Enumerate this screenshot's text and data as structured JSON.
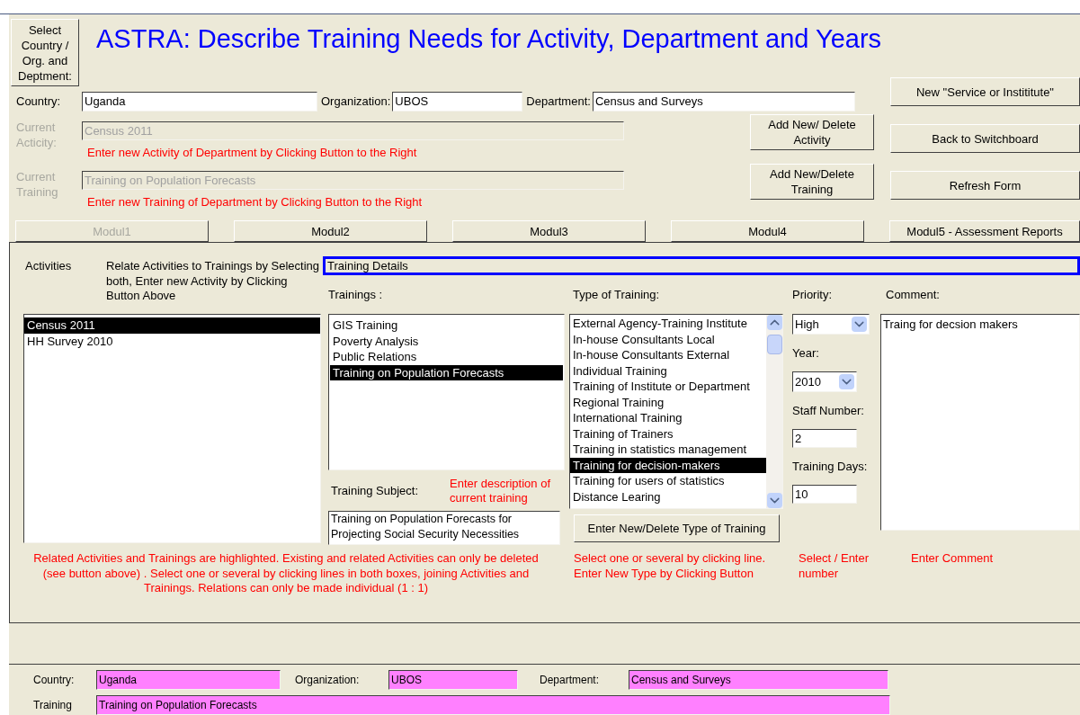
{
  "select_button": "Select Country / Org. and Deptment:",
  "title": "ASTRA: Describe Training Needs for Activity, Department and Years",
  "header_fields": [
    {
      "label": "Country:",
      "value": "Uganda"
    },
    {
      "label": "Organization:",
      "value": "UBOS"
    },
    {
      "label": "Department:",
      "value": "Census and Surveys"
    }
  ],
  "current_activity": {
    "label": "Current Acticity:",
    "value": "Census 2011",
    "disabled": true,
    "hint": "Enter new Activity of Department by Clicking Button to the Right",
    "button": "Add New/ Delete Activity"
  },
  "current_training": {
    "label": "Current Training",
    "value": "Training on Population Forecasts",
    "disabled": true,
    "hint": "Enter new Training of Department by Clicking Button to the Right",
    "button": "Add New/Delete Training"
  },
  "side_buttons": [
    "New \"Service or Instititute\"",
    "Back to Switchboard",
    "Refresh Form"
  ],
  "tabs": [
    {
      "label": "Modul1",
      "disabled": true
    },
    {
      "label": "Modul2",
      "disabled": false
    },
    {
      "label": "Modul3",
      "disabled": false
    },
    {
      "label": "Modul4",
      "disabled": false
    },
    {
      "label": "Modul5 - Assessment Reports",
      "disabled": false
    }
  ],
  "activities": {
    "label": "Activities",
    "hint": "Relate Activities to Trainings by Selecting both, Enter new Activity by Clicking Button Above",
    "items": [
      {
        "label": "Census 2011",
        "selected": true
      },
      {
        "label": "HH Survey 2010",
        "selected": false
      }
    ],
    "note": "Related Activities and Trainings are highlighted. Existing and related Activities can only be deleted  (see button above) . Select one or several by clicking lines in both boxes, joining Activities and Trainings. Relations can only be made individual (1 : 1)"
  },
  "details_title": "Training Details",
  "trainings": {
    "label": "Trainings :",
    "items": [
      {
        "label": "GIS Training",
        "selected": false
      },
      {
        "label": "Poverty Analysis",
        "selected": false
      },
      {
        "label": "Public Relations",
        "selected": false
      },
      {
        "label": "Training on Population Forecasts",
        "selected": true
      }
    ],
    "subject_label": "Training Subject:",
    "subject_hint": "Enter description of current training",
    "subject_value": "Training on Population Forecasts for Projecting Social Security Necessities"
  },
  "training_types": {
    "label": "Type of Training:",
    "items": [
      {
        "label": "External Agency-Training Institute",
        "selected": false
      },
      {
        "label": "In-house Consultants Local",
        "selected": false
      },
      {
        "label": "In-house Consultants External",
        "selected": false
      },
      {
        "label": "Individual Training",
        "selected": false
      },
      {
        "label": "Training of Institute or Department",
        "selected": false
      },
      {
        "label": "Regional Training",
        "selected": false
      },
      {
        "label": "International Training",
        "selected": false
      },
      {
        "label": "Training of Trainers",
        "selected": false
      },
      {
        "label": "Training in statistics management",
        "selected": false
      },
      {
        "label": "Training for decision-makers",
        "selected": true
      },
      {
        "label": "Training for users of statistics",
        "selected": false
      },
      {
        "label": "Distance Learing",
        "selected": false
      }
    ],
    "button": "Enter New/Delete Type of Training",
    "hint": "Select one or several by clicking line. Enter New Type  by Clicking Button"
  },
  "numbers": [
    {
      "kind": "combo",
      "label": "Priority:",
      "value": "High"
    },
    {
      "kind": "combo",
      "label": "Year:",
      "value": "2010"
    },
    {
      "kind": "input",
      "label": "Staff Number:",
      "value": "2"
    },
    {
      "kind": "input",
      "label": "Training Days:",
      "value": "10"
    }
  ],
  "numbers_hint": "Select / Enter number",
  "comment": {
    "label": "Comment:",
    "value": "Traing for decsion makers",
    "hint": "Enter Comment"
  },
  "footer": {
    "fields": [
      {
        "label": "Country:",
        "value": "Uganda"
      },
      {
        "label": "Organization:",
        "value": "UBOS"
      },
      {
        "label": "Department:",
        "value": "Census and Surveys"
      }
    ],
    "training": {
      "label": "Training",
      "value": "Training on Population Forecasts"
    }
  }
}
